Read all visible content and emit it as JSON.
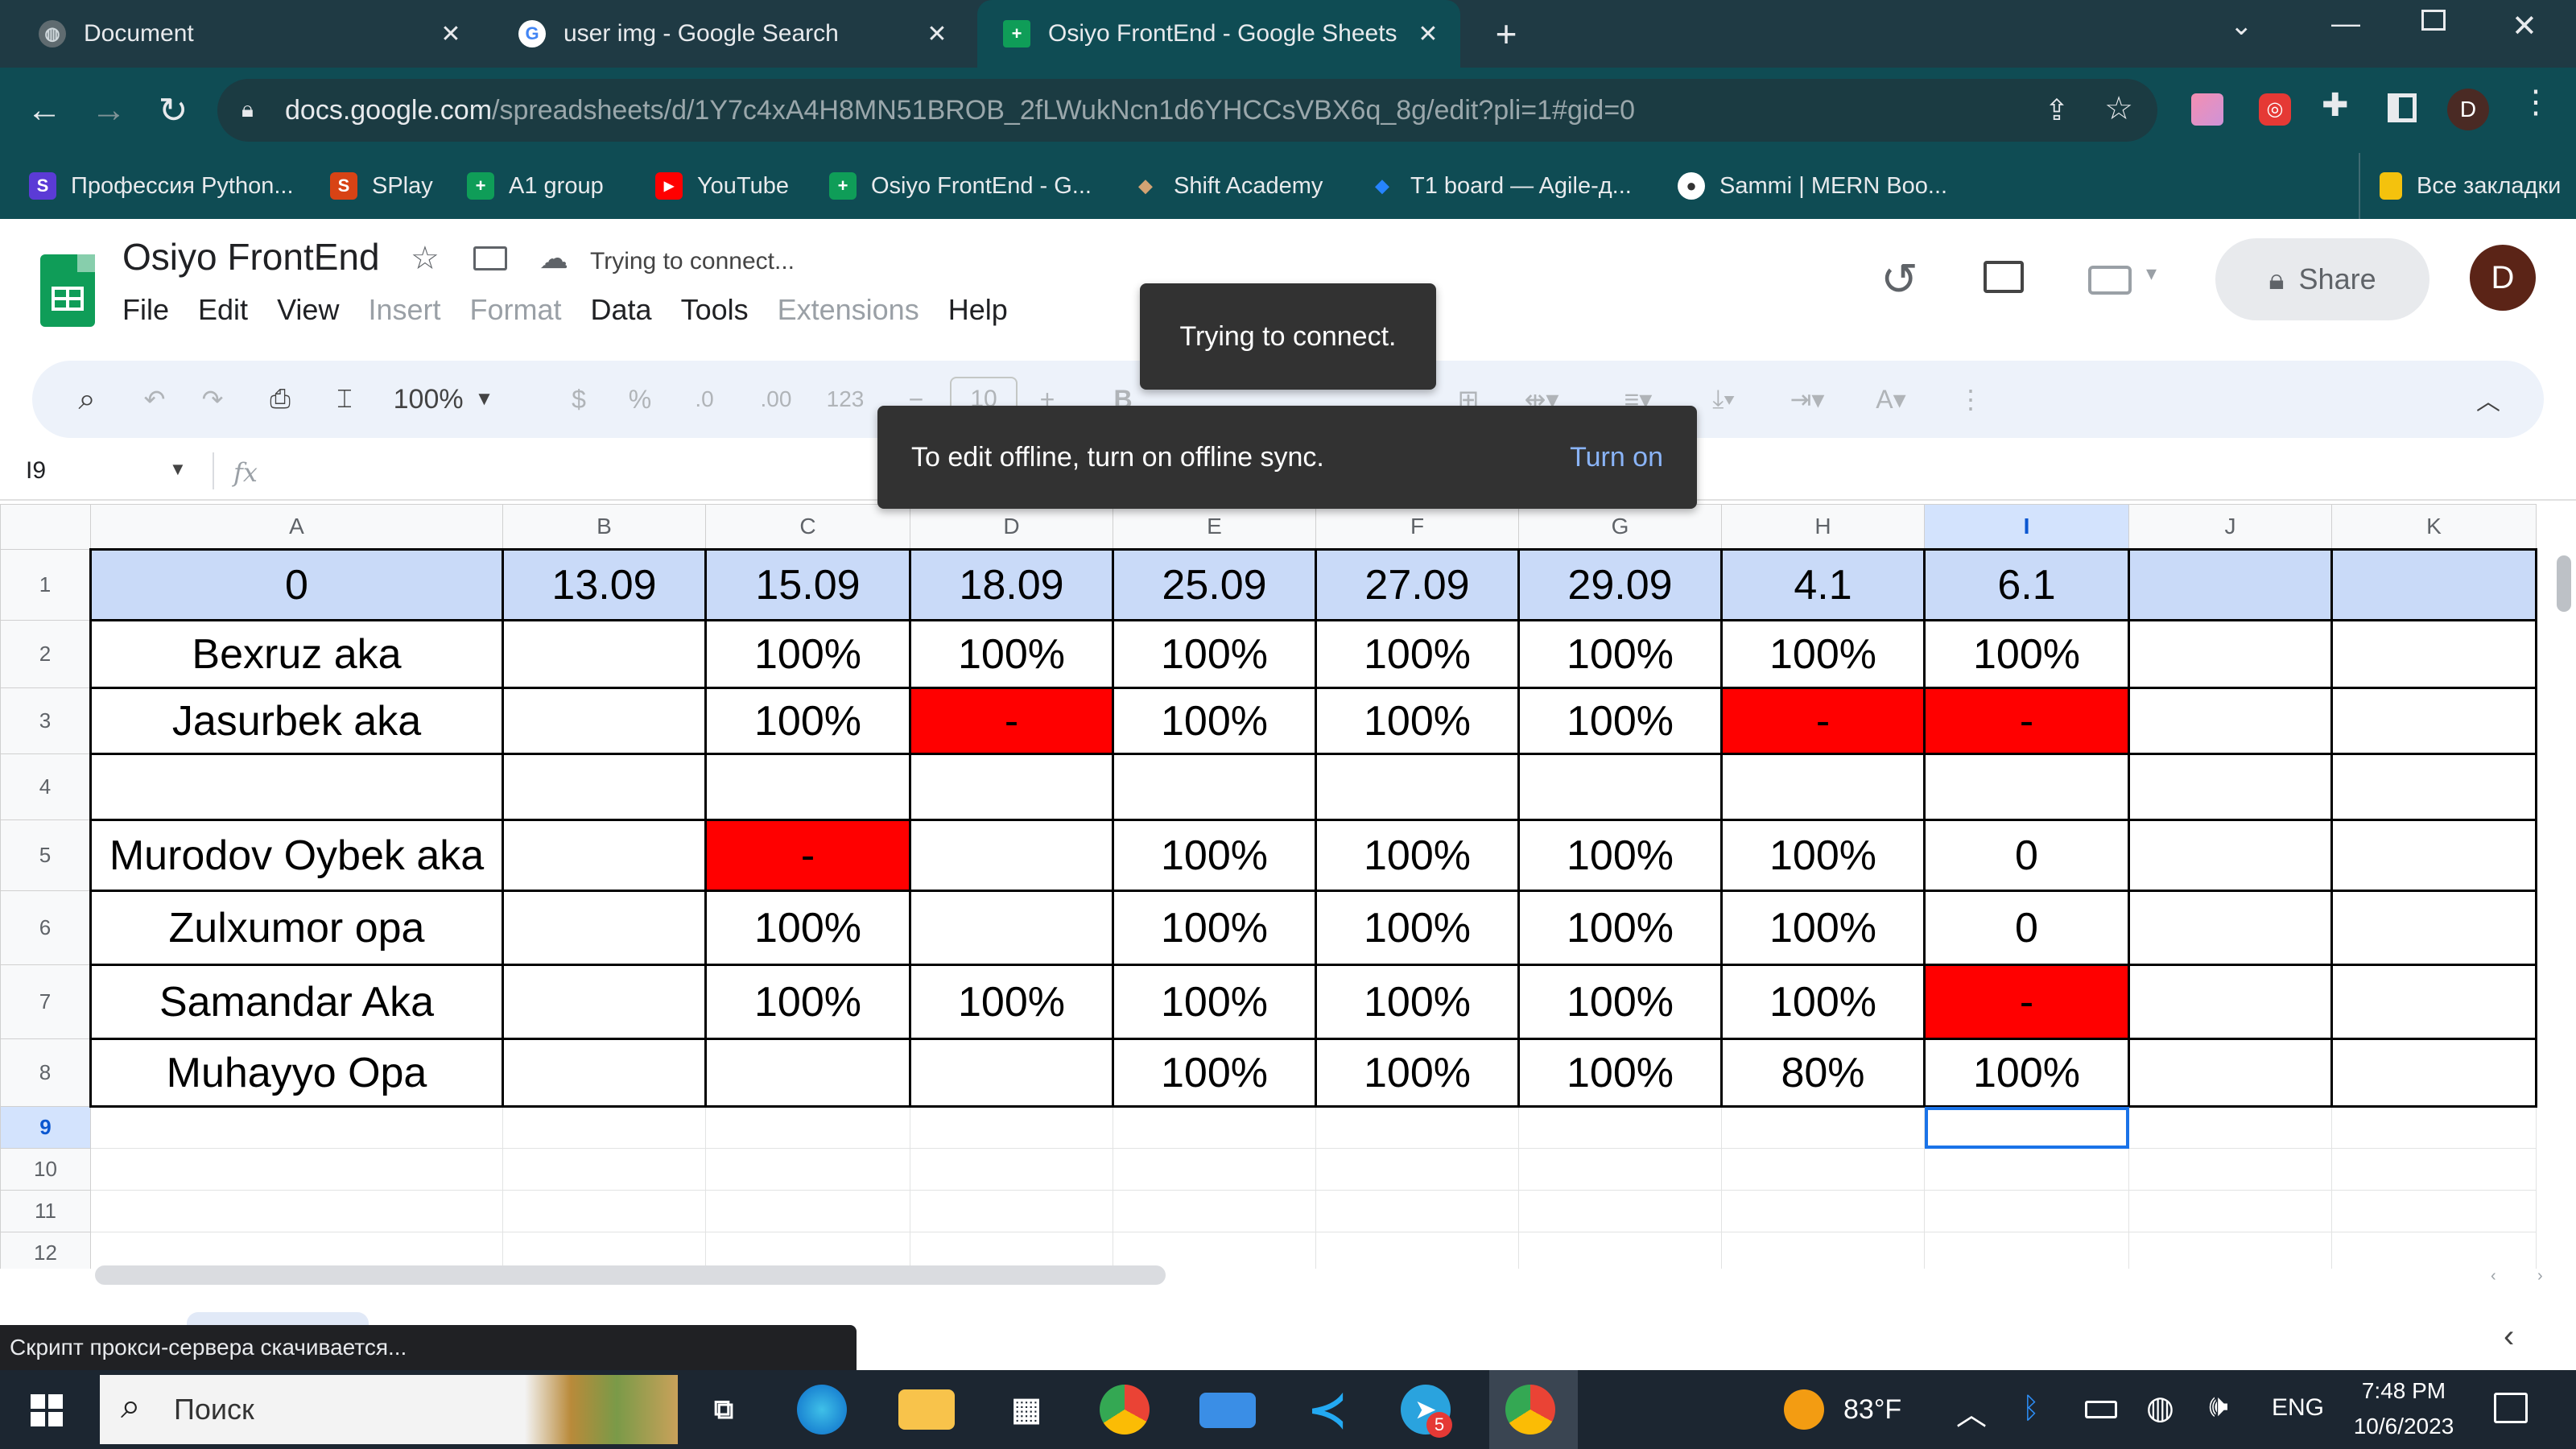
{
  "browser": {
    "tabs": [
      {
        "title": "Document",
        "icon": "globe-icon"
      },
      {
        "title": "user img - Google Search",
        "icon": "google-icon"
      },
      {
        "title": "Osiyo FrontEnd - Google Sheets",
        "icon": "sheets-icon",
        "active": true
      }
    ],
    "new_tab": "+",
    "url_host": "docs.google.com",
    "url_path": "/spreadsheets/d/1Y7c4xA4H8MN51BROB_2fLWukNcn1d6YHCCsVBX6q_8g/edit?pli=1#gid=0",
    "profile_initial": "D",
    "bookmarks": [
      {
        "label": "Профессия Python...",
        "icon": "S"
      },
      {
        "label": "SPlay",
        "icon": "S"
      },
      {
        "label": "A1 group",
        "icon": "+"
      },
      {
        "label": "YouTube",
        "icon": "▶"
      },
      {
        "label": "Osiyo FrontEnd - G...",
        "icon": "+"
      },
      {
        "label": "Shift Academy",
        "icon": "◆"
      },
      {
        "label": "T1 board — Agile-д...",
        "icon": "◆"
      },
      {
        "label": "Sammi | MERN Boo...",
        "icon": "●"
      }
    ],
    "all_bookmarks": "Все закладки"
  },
  "sheets": {
    "doc_title": "Osiyo FrontEnd",
    "status": "Trying to connect...",
    "menus": [
      {
        "label": "File",
        "enabled": true
      },
      {
        "label": "Edit",
        "enabled": true
      },
      {
        "label": "View",
        "enabled": true
      },
      {
        "label": "Insert",
        "enabled": false
      },
      {
        "label": "Format",
        "enabled": false
      },
      {
        "label": "Data",
        "enabled": true
      },
      {
        "label": "Tools",
        "enabled": true
      },
      {
        "label": "Extensions",
        "enabled": false
      },
      {
        "label": "Help",
        "enabled": true
      }
    ],
    "share_label": "Share",
    "user_initial": "D",
    "zoom": "100%",
    "font_size": "10",
    "currency": "$",
    "percent": "%",
    "decimal_dec": ".0",
    "decimal_inc": ".00",
    "number_format": "123",
    "name_box": "I9",
    "fx": "fx",
    "toast_connect": "Trying to connect.",
    "toast_offline": "To edit offline, turn on offline sync.",
    "toast_action": "Turn on",
    "selected_cell": "I9",
    "colors": {
      "header_fill": "#c9daf8",
      "missed_fill": "#ff0000",
      "accent": "#1a73e8"
    }
  },
  "grid": {
    "columns": [
      "A",
      "B",
      "C",
      "D",
      "E",
      "F",
      "G",
      "H",
      "I",
      "J",
      "K"
    ],
    "row_numbers": [
      "1",
      "2",
      "3",
      "4",
      "5",
      "6",
      "7",
      "8",
      "9",
      "10",
      "11",
      "12"
    ],
    "rows": [
      [
        "0",
        "13.09",
        "15.09",
        "18.09",
        "25.09",
        "27.09",
        "29.09",
        "4.1",
        "6.1",
        "",
        ""
      ],
      [
        "Bexruz aka",
        "",
        "100%",
        "100%",
        "100%",
        "100%",
        "100%",
        "100%",
        "100%",
        "",
        ""
      ],
      [
        "Jasurbek aka",
        "",
        "100%",
        "-",
        "100%",
        "100%",
        "100%",
        "-",
        "-",
        "",
        ""
      ],
      [
        "",
        "",
        "",
        "",
        "",
        "",
        "",
        "",
        "",
        "",
        ""
      ],
      [
        "Murodov Oybek aka",
        "",
        "-",
        "",
        "100%",
        "100%",
        "100%",
        "100%",
        "0",
        "",
        ""
      ],
      [
        "Zulxumor opa",
        "",
        "100%",
        "",
        "100%",
        "100%",
        "100%",
        "100%",
        "0",
        "",
        ""
      ],
      [
        "Samandar Aka",
        "",
        "100%",
        "100%",
        "100%",
        "100%",
        "100%",
        "100%",
        "-",
        "",
        ""
      ],
      [
        "Muhayyo Opa",
        "",
        "",
        "",
        "100%",
        "100%",
        "100%",
        "80%",
        "100%",
        "",
        ""
      ],
      [
        "",
        "",
        "",
        "",
        "",
        "",
        "",
        "",
        "",
        "",
        ""
      ],
      [
        "",
        "",
        "",
        "",
        "",
        "",
        "",
        "",
        "",
        "",
        ""
      ],
      [
        "",
        "",
        "",
        "",
        "",
        "",
        "",
        "",
        "",
        "",
        ""
      ],
      [
        "",
        "",
        "",
        "",
        "",
        "",
        "",
        "",
        "",
        "",
        ""
      ]
    ]
  },
  "status_bar": "Скрипт прокси-сервера скачивается...",
  "taskbar": {
    "search_placeholder": "Поиск",
    "weather": "83°F",
    "language": "ENG",
    "time": "7:48 PM",
    "date": "10/6/2023",
    "telegram_badge": "5"
  }
}
